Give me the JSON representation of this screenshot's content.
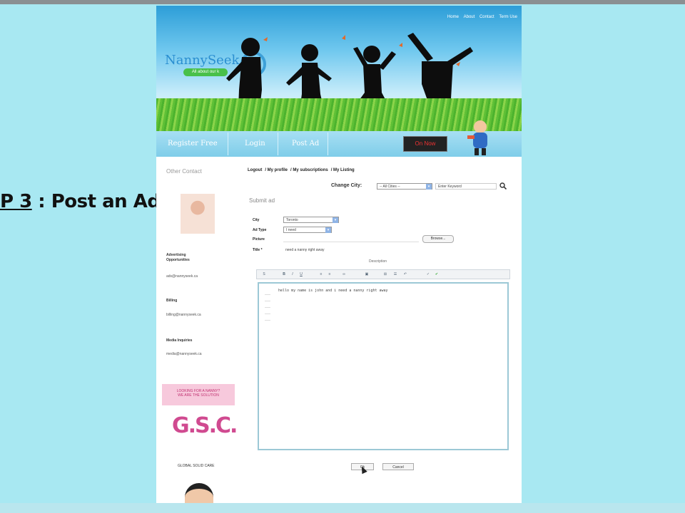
{
  "caption": {
    "prefix": "P 3",
    "rest": ": Post an Ad"
  },
  "header": {
    "toplinks": [
      "Home",
      "About",
      "Contact",
      "Term Use"
    ],
    "logo": "NannySeek",
    "tagline": "All about our k"
  },
  "nav": {
    "items": [
      "Register Free",
      "Login",
      "Post Ad"
    ],
    "banner": "On Now"
  },
  "sidebar": {
    "title": "Other Contact",
    "sections": [
      {
        "label": "Advertising Opportunities",
        "email": "ads@nannyseek.ca"
      },
      {
        "label": "Billing",
        "email": "billing@nannyseek.ca"
      },
      {
        "label": "Media Inquiries",
        "email": "media@nannyseek.ca"
      }
    ],
    "banner_text": "LOOKING FOR A NANNY?",
    "banner_sub": "WE ARE THE SOLUTION",
    "gsc_logo": "G.S.C.",
    "gsc_sub": "GLOBAL SOLID CARE"
  },
  "usernav": [
    "Logout",
    "My profile",
    "My subscriptions",
    "My Listing"
  ],
  "city": {
    "label": "Change City:",
    "selected": "-- All Cities --",
    "keyword_placeholder": "Enter Keyword"
  },
  "form": {
    "title": "Submit ad",
    "fields": {
      "city_label": "City",
      "city_value": "Toronto",
      "adtype_label": "Ad Type",
      "adtype_value": "I need",
      "picture_label": "Picture",
      "browse": "Browse...",
      "title_label": "Title *",
      "title_value": "need a nanny right away"
    },
    "description_label": "Description",
    "editor_text": "hello my name is john and i need a nanny right away",
    "ok": "Ok",
    "cancel": "Cancel"
  }
}
